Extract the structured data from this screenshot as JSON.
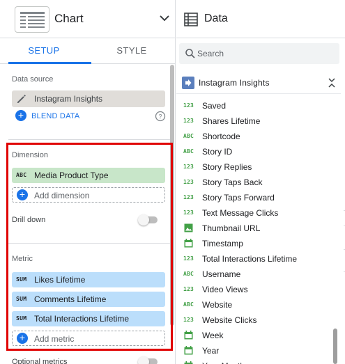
{
  "chart_panel": {
    "title": "Chart",
    "tabs": [
      {
        "label": "SETUP",
        "active": true
      },
      {
        "label": "STYLE",
        "active": false
      }
    ]
  },
  "setup": {
    "data_source": {
      "label": "Data source",
      "value": "Instagram Insights",
      "blend_label": "BLEND DATA"
    },
    "dimension": {
      "label": "Dimension",
      "items": [
        {
          "type": "ABC",
          "label": "Media Product Type"
        }
      ],
      "add_label": "Add dimension"
    },
    "drill_down": {
      "label": "Drill down",
      "enabled": false
    },
    "metric": {
      "label": "Metric",
      "items": [
        {
          "type": "SUM",
          "label": "Likes Lifetime"
        },
        {
          "type": "SUM",
          "label": "Comments Lifetime"
        },
        {
          "type": "SUM",
          "label": "Total Interactions Lifetime"
        }
      ],
      "add_label": "Add metric"
    },
    "optional_metrics": {
      "label": "Optional metrics",
      "enabled": false
    }
  },
  "data_panel": {
    "title": "Data",
    "search": {
      "placeholder": "Search",
      "value": ""
    },
    "source": "Instagram Insights",
    "fields": [
      {
        "type": "123",
        "name": "Saved"
      },
      {
        "type": "123",
        "name": "Shares Lifetime"
      },
      {
        "type": "ABC",
        "name": "Shortcode"
      },
      {
        "type": "ABC",
        "name": "Story ID"
      },
      {
        "type": "123",
        "name": "Story Replies"
      },
      {
        "type": "123",
        "name": "Story Taps Back"
      },
      {
        "type": "123",
        "name": "Story Taps Forward"
      },
      {
        "type": "123",
        "name": "Text Message Clicks"
      },
      {
        "type": "image",
        "name": "Thumbnail URL"
      },
      {
        "type": "date",
        "name": "Timestamp"
      },
      {
        "type": "123",
        "name": "Total Interactions Lifetime"
      },
      {
        "type": "ABC",
        "name": "Username"
      },
      {
        "type": "123",
        "name": "Video Views"
      },
      {
        "type": "ABC",
        "name": "Website"
      },
      {
        "type": "123",
        "name": "Website Clicks"
      },
      {
        "type": "date",
        "name": "Week"
      },
      {
        "type": "date",
        "name": "Year"
      },
      {
        "type": "date",
        "name": "Year Month"
      }
    ]
  },
  "colors": {
    "accent": "#1a73e8",
    "dimension_chip": "#c8e6c9",
    "metric_chip": "#bbdefb",
    "field_type_green": "#43a047",
    "highlight_border": "#e00000"
  }
}
